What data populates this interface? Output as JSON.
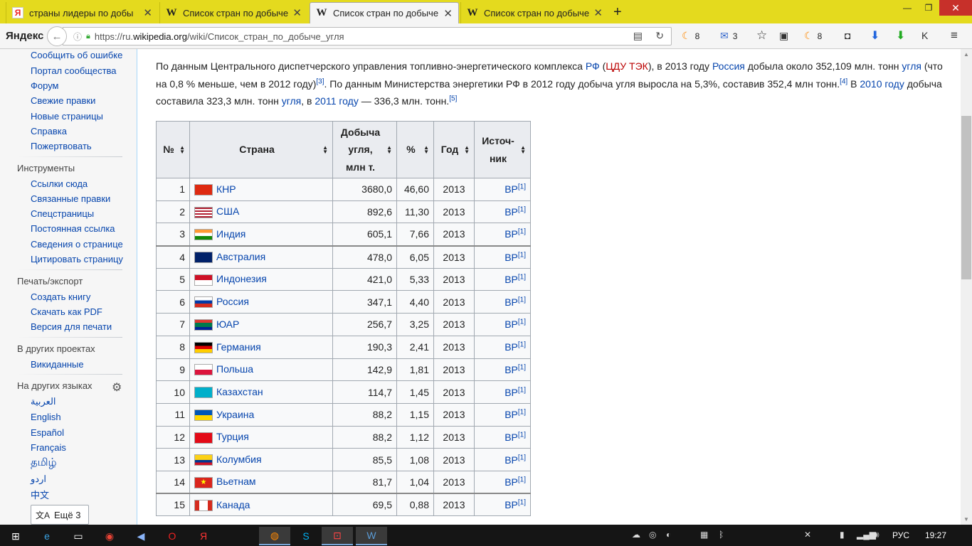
{
  "tabs": [
    {
      "title": "страны лидеры по добы",
      "icon": "yandex-icon"
    },
    {
      "title": "Список стран по добыче",
      "icon": "wikipedia-icon"
    },
    {
      "title": "Список стран по добыче",
      "icon": "wikipedia-icon",
      "active": true
    },
    {
      "title": "Список стран по добыче",
      "icon": "wikipedia-icon"
    }
  ],
  "browser": {
    "logo": "Яндекс",
    "url_prefix": "https://ru.",
    "url_host": "wikipedia.org",
    "url_path": "/wiki/Список_стран_по_добыче_угля",
    "counter1": "8",
    "mail_count": "3",
    "counter2": "8"
  },
  "sidebar": {
    "links_top": [
      "Сообщить об ошибке",
      "Портал сообщества",
      "Форум",
      "Свежие правки",
      "Новые страницы",
      "Справка",
      "Пожертвовать"
    ],
    "tools_heading": "Инструменты",
    "tools": [
      "Ссылки сюда",
      "Связанные правки",
      "Спецстраницы",
      "Постоянная ссылка",
      "Сведения о странице",
      "Цитировать страницу"
    ],
    "print_heading": "Печать/экспорт",
    "print": [
      "Создать книгу",
      "Скачать как PDF",
      "Версия для печати"
    ],
    "projects_heading": "В других проектах",
    "projects": [
      "Викиданные"
    ],
    "langs_heading": "На других языках",
    "langs": [
      "العربية",
      "English",
      "Español",
      "Français",
      "தமிழ்",
      "اردو",
      "中文"
    ],
    "more_label": "Ещё 3"
  },
  "paragraph": {
    "p1": "По данным Центрального диспетчерского управления топливно-энергетического комплекса ",
    "l_rf": "РФ",
    "p2": " (",
    "l_cdu": "ЦДУ ТЭК",
    "p3": "), в 2013 году ",
    "l_russia": "Россия",
    "p4": " добыла около 352,109 млн. тонн ",
    "l_coal": "угля",
    "p5": " (что на 0,8 % меньше, чем в 2012 году)",
    "ref3": "[3]",
    "p6": ". По данным Министерства энергетики РФ в 2012 году добыча угля выросла на 5,3%, составив 352,4 млн тонн.",
    "ref4": "[4]",
    "p7": " В ",
    "l_2010": "2010 году",
    "p8": " добыча составила 323,3 млн. тонн ",
    "l_coal2": "угля",
    "p9": ", в ",
    "l_2011": "2011 году",
    "p10": " — 336,3 млн. тонн.",
    "ref5": "[5]"
  },
  "table": {
    "headers": {
      "num": "№",
      "country": "Страна",
      "production_l1": "Добыча",
      "production_l2": "угля,",
      "production_l3": "млн т.",
      "percent": "%",
      "year": "Год",
      "source_l1": "Источ-",
      "source_l2": "ник"
    },
    "rows": [
      {
        "n": "1",
        "country": "КНР",
        "prod": "3680,0",
        "pct": "46,60",
        "year": "2013",
        "src": "BP",
        "ref": "[1]"
      },
      {
        "n": "2",
        "country": "США",
        "prod": "892,6",
        "pct": "11,30",
        "year": "2013",
        "src": "BP",
        "ref": "[1]"
      },
      {
        "n": "3",
        "country": "Индия",
        "prod": "605,1",
        "pct": "7,66",
        "year": "2013",
        "src": "BP",
        "ref": "[1]"
      },
      {
        "n": "4",
        "country": "Австралия",
        "prod": "478,0",
        "pct": "6,05",
        "year": "2013",
        "src": "BP",
        "ref": "[1]"
      },
      {
        "n": "5",
        "country": "Индонезия",
        "prod": "421,0",
        "pct": "5,33",
        "year": "2013",
        "src": "BP",
        "ref": "[1]"
      },
      {
        "n": "6",
        "country": "Россия",
        "prod": "347,1",
        "pct": "4,40",
        "year": "2013",
        "src": "BP",
        "ref": "[1]"
      },
      {
        "n": "7",
        "country": "ЮАР",
        "prod": "256,7",
        "pct": "3,25",
        "year": "2013",
        "src": "BP",
        "ref": "[1]"
      },
      {
        "n": "8",
        "country": "Германия",
        "prod": "190,3",
        "pct": "2,41",
        "year": "2013",
        "src": "BP",
        "ref": "[1]"
      },
      {
        "n": "9",
        "country": "Польша",
        "prod": "142,9",
        "pct": "1,81",
        "year": "2013",
        "src": "BP",
        "ref": "[1]"
      },
      {
        "n": "10",
        "country": "Казахстан",
        "prod": "114,7",
        "pct": "1,45",
        "year": "2013",
        "src": "BP",
        "ref": "[1]"
      },
      {
        "n": "11",
        "country": "Украина",
        "prod": "88,2",
        "pct": "1,15",
        "year": "2013",
        "src": "BP",
        "ref": "[1]"
      },
      {
        "n": "12",
        "country": "Турция",
        "prod": "88,2",
        "pct": "1,12",
        "year": "2013",
        "src": "BP",
        "ref": "[1]"
      },
      {
        "n": "13",
        "country": "Колумбия",
        "prod": "85,5",
        "pct": "1,08",
        "year": "2013",
        "src": "BP",
        "ref": "[1]"
      },
      {
        "n": "14",
        "country": "Вьетнам",
        "prod": "81,7",
        "pct": "1,04",
        "year": "2013",
        "src": "BP",
        "ref": "[1]"
      },
      {
        "n": "15",
        "country": "Канада",
        "prod": "69,5",
        "pct": "0,88",
        "year": "2013",
        "src": "BP",
        "ref": "[1]"
      }
    ]
  },
  "taskbar": {
    "lang": "РУС",
    "time": "19:27"
  }
}
